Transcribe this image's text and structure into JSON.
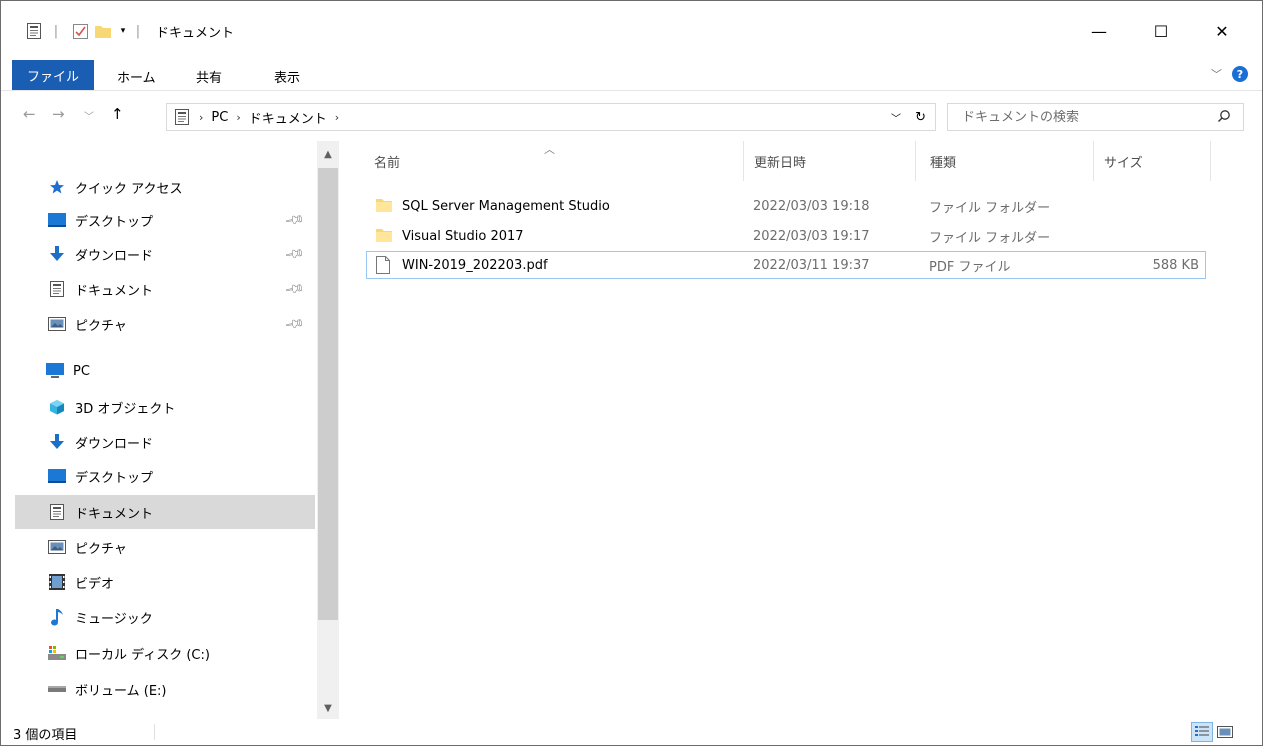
{
  "window": {
    "title": "ドキュメント",
    "minimize_glyph": "—",
    "maximize_glyph": "☐",
    "close_glyph": "✕"
  },
  "ribbon": {
    "tabs": [
      "ファイル",
      "ホーム",
      "共有",
      "表示"
    ]
  },
  "navigation": {
    "breadcrumb": [
      "PC",
      "ドキュメント"
    ],
    "search_placeholder": "ドキュメントの検索"
  },
  "nav_pane": {
    "quick_access": "クイック アクセス",
    "pinned": [
      {
        "label": "デスクトップ",
        "icon": "desktop-icon"
      },
      {
        "label": "ダウンロード",
        "icon": "download-icon"
      },
      {
        "label": "ドキュメント",
        "icon": "document-icon"
      },
      {
        "label": "ピクチャ",
        "icon": "picture-icon"
      }
    ],
    "pc": "PC",
    "pc_items": [
      {
        "label": "3D オブジェクト",
        "icon": "3d-objects-icon"
      },
      {
        "label": "ダウンロード",
        "icon": "download-icon"
      },
      {
        "label": "デスクトップ",
        "icon": "desktop-icon"
      },
      {
        "label": "ドキュメント",
        "icon": "document-icon",
        "selected": true
      },
      {
        "label": "ピクチャ",
        "icon": "picture-icon"
      },
      {
        "label": "ビデオ",
        "icon": "video-icon"
      },
      {
        "label": "ミュージック",
        "icon": "music-icon"
      },
      {
        "label": "ローカル ディスク (C:)",
        "icon": "local-disk-icon"
      },
      {
        "label": "ボリューム (E:)",
        "icon": "volume-icon"
      }
    ]
  },
  "file_list": {
    "columns": [
      "名前",
      "更新日時",
      "種類",
      "サイズ"
    ],
    "rows": [
      {
        "name": "SQL Server Management Studio",
        "modified": "2022/03/03 19:18",
        "type": "ファイル フォルダー",
        "size": "",
        "icon": "folder-icon"
      },
      {
        "name": "Visual Studio 2017",
        "modified": "2022/03/03 19:17",
        "type": "ファイル フォルダー",
        "size": "",
        "icon": "folder-icon"
      },
      {
        "name": "WIN-2019_202203.pdf",
        "modified": "2022/03/11 19:37",
        "type": "PDF ファイル",
        "size": "588 KB",
        "icon": "file-icon",
        "selected": true
      }
    ]
  },
  "status": {
    "item_count": "3 個の項目"
  },
  "colors": {
    "file_tab": "#1a5eb4",
    "folder": "#f8d775",
    "selection": "#d9d9d9",
    "selection_border": "#99c8f5"
  }
}
